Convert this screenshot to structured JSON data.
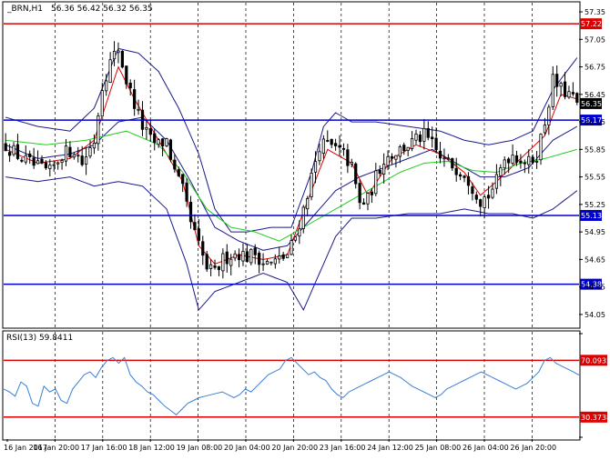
{
  "header": {
    "symbol": "_BRN,H1",
    "ohlc": "56.36 56.42 56.32 56.35"
  },
  "colors": {
    "candle": "#000000",
    "level_line": "#0000cc",
    "resistance_line": "#dd0000",
    "bollinger": "#1a1a8c",
    "ma_fast": "#dd0000",
    "ma_slow": "#22cc22",
    "rsi_line": "#3b7fd6",
    "rsi_bound": "#dd0000",
    "current_price_bg": "#000000",
    "grid": "#000000"
  },
  "chart_data": [
    {
      "type": "candlestick",
      "title": "_BRN,H1",
      "ylim": [
        53.95,
        57.4
      ],
      "y_ticks": [
        "57.35",
        "57.05",
        "56.75",
        "56.45",
        "56.15",
        "55.85",
        "55.55",
        "55.25",
        "54.95",
        "54.65",
        "54.35",
        "54.05"
      ],
      "x_tick_labels": [
        "16 Jan 2017",
        "16 Jan 20:00",
        "17 Jan 16:00",
        "18 Jan 12:00",
        "19 Jan 08:00",
        "20 Jan 04:00",
        "20 Jan 20:00",
        "23 Jan 16:00",
        "24 Jan 12:00",
        "25 Jan 08:00",
        "26 Jan 04:00",
        "26 Jan 20:00"
      ],
      "current_price": "56.35",
      "horizontal_levels": [
        {
          "label": "57.22",
          "value": 57.22,
          "color": "#dd0000"
        },
        {
          "label": "56.17",
          "value": 56.17,
          "color": "#0000cc"
        },
        {
          "label": "55.13",
          "value": 55.13,
          "color": "#0000cc"
        },
        {
          "label": "54.38",
          "value": 54.38,
          "color": "#0000cc"
        }
      ],
      "close_path": [
        [
          0,
          55.9
        ],
        [
          4,
          55.75
        ],
        [
          8,
          55.65
        ],
        [
          11,
          55.6
        ],
        [
          14,
          55.8
        ],
        [
          17,
          55.85
        ],
        [
          19,
          55.7
        ],
        [
          22,
          55.95
        ],
        [
          24,
          56.55
        ],
        [
          26,
          56.8
        ],
        [
          28,
          56.95
        ],
        [
          30,
          56.6
        ],
        [
          32,
          56.35
        ],
        [
          34,
          56.1
        ],
        [
          36,
          55.95
        ],
        [
          38,
          55.9
        ],
        [
          40,
          55.95
        ],
        [
          42,
          55.6
        ],
        [
          44,
          55.4
        ],
        [
          46,
          55.05
        ],
        [
          48,
          54.8
        ],
        [
          50,
          54.55
        ],
        [
          52,
          54.5
        ],
        [
          54,
          54.65
        ],
        [
          56,
          54.7
        ],
        [
          58,
          54.72
        ],
        [
          60,
          54.68
        ],
        [
          62,
          54.72
        ],
        [
          64,
          54.62
        ],
        [
          66,
          54.6
        ],
        [
          68,
          54.65
        ],
        [
          70,
          54.7
        ],
        [
          72,
          54.9
        ],
        [
          74,
          55.2
        ],
        [
          76,
          55.55
        ],
        [
          78,
          55.9
        ],
        [
          80,
          55.9
        ],
        [
          82,
          55.85
        ],
        [
          84,
          55.8
        ],
        [
          86,
          55.65
        ],
        [
          88,
          55.25
        ],
        [
          90,
          55.3
        ],
        [
          92,
          55.55
        ],
        [
          94,
          55.75
        ],
        [
          96,
          55.8
        ],
        [
          98,
          55.85
        ],
        [
          100,
          55.9
        ],
        [
          102,
          55.95
        ],
        [
          104,
          56.0
        ],
        [
          106,
          55.9
        ],
        [
          108,
          55.75
        ],
        [
          110,
          55.7
        ],
        [
          112,
          55.65
        ],
        [
          114,
          55.6
        ],
        [
          116,
          55.45
        ],
        [
          118,
          55.3
        ],
        [
          120,
          55.35
        ],
        [
          122,
          55.5
        ],
        [
          124,
          55.75
        ],
        [
          126,
          55.8
        ],
        [
          128,
          55.75
        ],
        [
          130,
          55.7
        ],
        [
          132,
          55.8
        ],
        [
          134,
          56.15
        ],
        [
          136,
          56.6
        ],
        [
          138,
          56.5
        ],
        [
          140,
          56.45
        ],
        [
          142,
          56.35
        ]
      ],
      "series": [
        {
          "kind": "bollinger_upper",
          "points": [
            [
              0,
              56.2
            ],
            [
              8,
              56.1
            ],
            [
              16,
              56.05
            ],
            [
              22,
              56.3
            ],
            [
              28,
              56.95
            ],
            [
              33,
              56.9
            ],
            [
              38,
              56.7
            ],
            [
              43,
              56.3
            ],
            [
              48,
              55.8
            ],
            [
              52,
              55.2
            ],
            [
              56,
              54.95
            ],
            [
              60,
              54.95
            ],
            [
              66,
              55.0
            ],
            [
              71,
              55.0
            ],
            [
              76,
              55.6
            ],
            [
              79,
              56.1
            ],
            [
              82,
              56.25
            ],
            [
              86,
              56.15
            ],
            [
              92,
              56.15
            ],
            [
              100,
              56.1
            ],
            [
              108,
              56.05
            ],
            [
              114,
              55.95
            ],
            [
              120,
              55.9
            ],
            [
              126,
              55.95
            ],
            [
              131,
              56.05
            ],
            [
              136,
              56.5
            ],
            [
              142,
              56.85
            ]
          ]
        },
        {
          "kind": "bollinger_middle",
          "points": [
            [
              0,
              55.9
            ],
            [
              8,
              55.75
            ],
            [
              16,
              55.8
            ],
            [
              22,
              55.9
            ],
            [
              28,
              56.15
            ],
            [
              34,
              56.2
            ],
            [
              40,
              55.95
            ],
            [
              46,
              55.5
            ],
            [
              52,
              55.0
            ],
            [
              58,
              54.85
            ],
            [
              64,
              54.75
            ],
            [
              70,
              54.8
            ],
            [
              76,
              55.1
            ],
            [
              82,
              55.4
            ],
            [
              88,
              55.55
            ],
            [
              94,
              55.65
            ],
            [
              100,
              55.75
            ],
            [
              106,
              55.85
            ],
            [
              112,
              55.7
            ],
            [
              118,
              55.55
            ],
            [
              124,
              55.55
            ],
            [
              130,
              55.65
            ],
            [
              136,
              55.95
            ],
            [
              142,
              56.1
            ]
          ]
        },
        {
          "kind": "bollinger_lower",
          "points": [
            [
              0,
              55.55
            ],
            [
              8,
              55.5
            ],
            [
              16,
              55.55
            ],
            [
              22,
              55.45
            ],
            [
              28,
              55.5
            ],
            [
              34,
              55.45
            ],
            [
              40,
              55.2
            ],
            [
              45,
              54.6
            ],
            [
              48,
              54.1
            ],
            [
              52,
              54.3
            ],
            [
              58,
              54.4
            ],
            [
              64,
              54.5
            ],
            [
              70,
              54.4
            ],
            [
              74,
              54.1
            ],
            [
              78,
              54.5
            ],
            [
              82,
              54.9
            ],
            [
              86,
              55.1
            ],
            [
              92,
              55.1
            ],
            [
              100,
              55.15
            ],
            [
              108,
              55.15
            ],
            [
              114,
              55.2
            ],
            [
              120,
              55.15
            ],
            [
              126,
              55.15
            ],
            [
              131,
              55.1
            ],
            [
              136,
              55.2
            ],
            [
              142,
              55.4
            ]
          ]
        },
        {
          "kind": "ma_fast",
          "points": [
            [
              0,
              55.85
            ],
            [
              8,
              55.7
            ],
            [
              16,
              55.75
            ],
            [
              22,
              55.95
            ],
            [
              28,
              56.75
            ],
            [
              32,
              56.4
            ],
            [
              38,
              55.95
            ],
            [
              44,
              55.5
            ],
            [
              48,
              54.8
            ],
            [
              52,
              54.6
            ],
            [
              58,
              54.7
            ],
            [
              64,
              54.65
            ],
            [
              70,
              54.7
            ],
            [
              76,
              55.4
            ],
            [
              80,
              55.85
            ],
            [
              86,
              55.7
            ],
            [
              90,
              55.35
            ],
            [
              96,
              55.75
            ],
            [
              102,
              55.9
            ],
            [
              108,
              55.8
            ],
            [
              114,
              55.6
            ],
            [
              118,
              55.35
            ],
            [
              122,
              55.5
            ],
            [
              128,
              55.75
            ],
            [
              134,
              56.0
            ],
            [
              138,
              56.45
            ],
            [
              142,
              56.4
            ]
          ]
        },
        {
          "kind": "ma_slow",
          "points": [
            [
              0,
              55.95
            ],
            [
              10,
              55.9
            ],
            [
              20,
              55.95
            ],
            [
              30,
              56.05
            ],
            [
              38,
              55.9
            ],
            [
              44,
              55.6
            ],
            [
              50,
              55.2
            ],
            [
              56,
              55.0
            ],
            [
              62,
              54.95
            ],
            [
              68,
              54.85
            ],
            [
              74,
              55.0
            ],
            [
              80,
              55.15
            ],
            [
              86,
              55.3
            ],
            [
              92,
              55.45
            ],
            [
              98,
              55.6
            ],
            [
              104,
              55.7
            ],
            [
              110,
              55.72
            ],
            [
              116,
              55.62
            ],
            [
              122,
              55.6
            ],
            [
              128,
              55.7
            ],
            [
              134,
              55.75
            ],
            [
              142,
              55.85
            ]
          ]
        }
      ]
    },
    {
      "type": "line",
      "title": "RSI(13) 59.8411",
      "ylim": [
        15,
        90
      ],
      "levels": [
        {
          "label": "70.0935",
          "value": 70.0935
        },
        {
          "label": "30.3738",
          "value": 30.3738
        }
      ],
      "series": [
        {
          "name": "RSI(13)",
          "values": [
            50,
            48,
            45,
            55,
            52,
            40,
            38,
            52,
            48,
            50,
            42,
            40,
            50,
            55,
            60,
            62,
            58,
            65,
            70,
            72,
            68,
            72,
            60,
            55,
            52,
            48,
            46,
            42,
            38,
            35,
            32,
            36,
            40,
            42,
            44,
            45,
            46,
            47,
            48,
            46,
            44,
            46,
            50,
            48,
            52,
            56,
            60,
            62,
            64,
            70,
            72,
            68,
            64,
            60,
            62,
            58,
            56,
            50,
            46,
            44,
            48,
            50,
            52,
            54,
            56,
            58,
            60,
            62,
            60,
            58,
            55,
            52,
            50,
            48,
            46,
            44,
            46,
            50,
            52,
            54,
            56,
            58,
            60,
            62,
            60,
            58,
            56,
            54,
            52,
            50,
            52,
            54,
            58,
            62,
            70,
            72,
            68,
            66,
            64,
            62,
            59.84
          ]
        }
      ]
    }
  ]
}
